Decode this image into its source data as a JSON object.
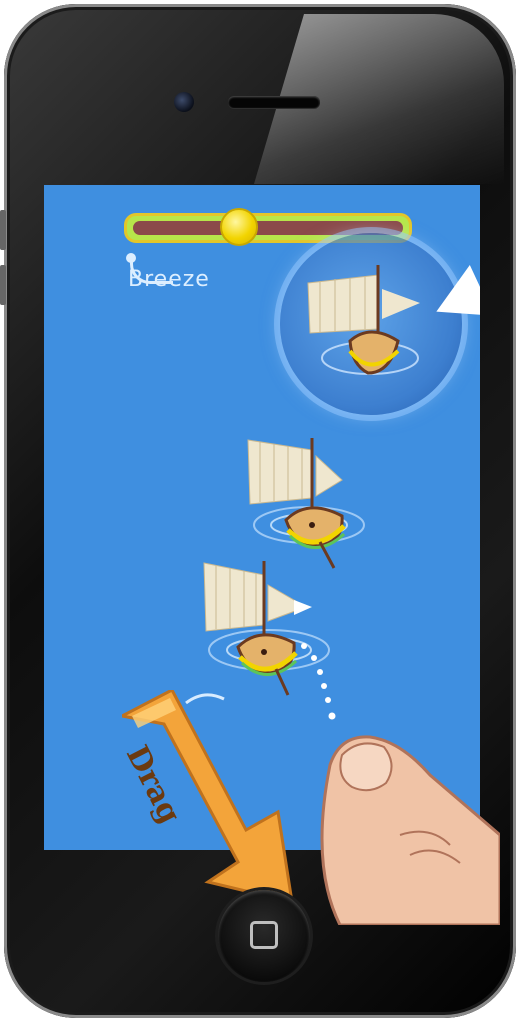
{
  "device": {
    "name": "iPhone"
  },
  "hud": {
    "wind_slider_label": "Breeze",
    "wind_slider_level": 0.38
  },
  "tutorial": {
    "drag_label": "Drag"
  },
  "colors": {
    "sea": "#3f8fe0",
    "slider_track": "#8b4a4a",
    "slider_knob": "#f2d400",
    "arrow": "#f3a43a"
  },
  "icons": {
    "wind_direction": "triangle-arrow-icon",
    "home": "home-square-icon"
  }
}
